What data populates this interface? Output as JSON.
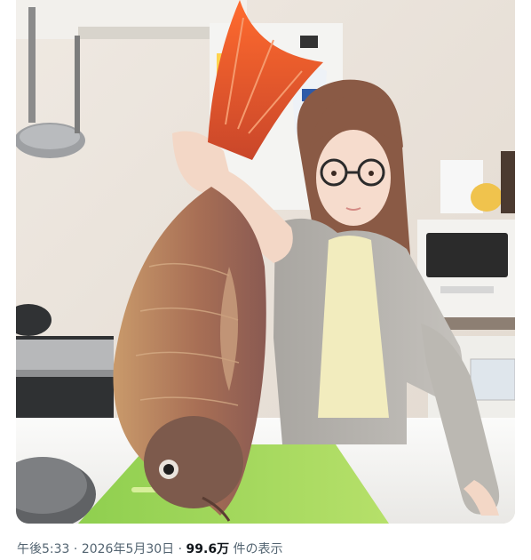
{
  "post": {
    "time": "午後5:33",
    "separator": "·",
    "date": "2026年5月30日",
    "views_count": "99.6万",
    "views_label": "件の表示"
  },
  "photo": {
    "description_icon": "photo-icon",
    "colors": {
      "wall": "#efe9e2",
      "counter": "#f4f3f0",
      "cutting_board": "#9fd35a",
      "fish_body": "#b07a5a",
      "fish_tail": "#e35d2d",
      "cardigan": "#b6b3ae",
      "hair": "#8a5a45"
    }
  }
}
